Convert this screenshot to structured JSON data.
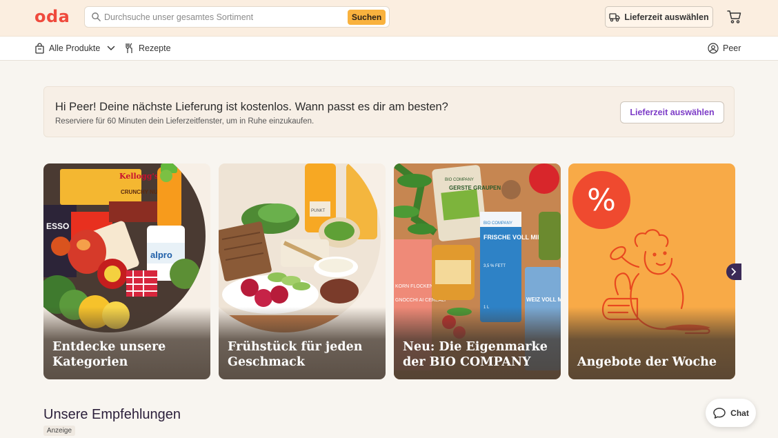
{
  "header": {
    "logo": "oda",
    "search": {
      "placeholder": "Durchsuche unser gesamtes Sortiment",
      "button_label": "Suchen",
      "icon": "search-icon"
    },
    "delivery_button": {
      "label": "Lieferzeit auswählen",
      "icon": "delivery-truck-icon"
    },
    "cart_icon": "cart-icon"
  },
  "nav": {
    "all_products": {
      "label": "Alle Produkte",
      "icon": "grocery-bag-icon"
    },
    "recipes": {
      "label": "Rezepte",
      "icon": "cutlery-icon"
    },
    "user": {
      "label": "Peer",
      "icon": "user-icon"
    }
  },
  "promo": {
    "title": "Hi Peer! Deine nächste Lieferung ist kostenlos. Wann passt es dir am besten?",
    "subtitle": "Reserviere für 60 Minuten dein Lieferzeitfenster, um in Ruhe einzukaufen.",
    "button_label": "Lieferzeit auswählen"
  },
  "cards": [
    {
      "title": "Entdecke unsere Kategorien",
      "image_text": [
        "Kellogg's",
        "CRUNCHY NUT",
        "alpro",
        "ESSO"
      ]
    },
    {
      "title": "Frühstück für jeden Geschmack",
      "image_text": [
        "PUNKT"
      ]
    },
    {
      "title": "Neu: Die Eigenmarke der BIO COMPANY",
      "image_text": [
        "BIO COMPANY",
        "GERSTE GRAUPEN",
        "FRISCHE VOLL MILCH",
        "3,5 % FETT",
        "1 L",
        "KORN FLOCKEN",
        "GNOCCHI AI CEREALI",
        "WEIZ VOLL MEHL"
      ]
    },
    {
      "title": "Angebote der Woche",
      "badge": "%"
    }
  ],
  "carousel_next_icon": "chevron-right-icon",
  "recommendations": {
    "title": "Unsere Empfehlungen",
    "ad_label": "Anzeige"
  },
  "chat": {
    "label": "Chat",
    "icon": "chat-bubble-icon"
  },
  "colors": {
    "brand": "#ef4a3d",
    "search_button": "#f9b23e",
    "accent_purple": "#7d3cc7",
    "offer_orange": "#f8aa47"
  }
}
